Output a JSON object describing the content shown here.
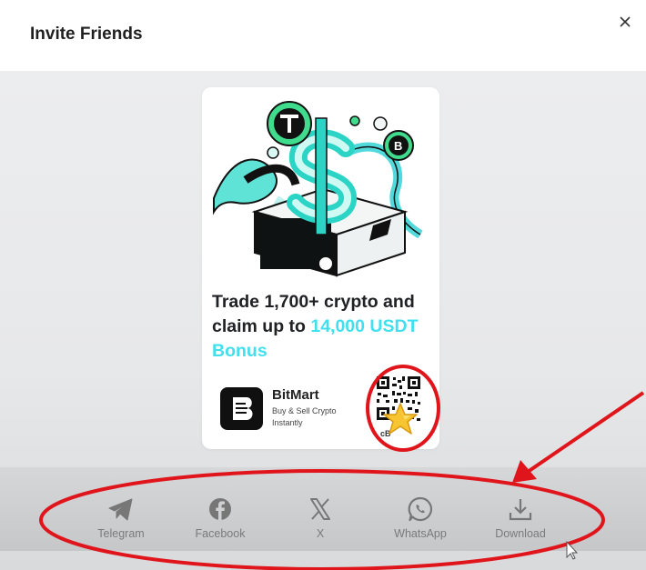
{
  "modal": {
    "title": "Invite Friends",
    "close_icon": "close-icon"
  },
  "card": {
    "headline_part1": "Trade 1,700+ crypto and claim up to ",
    "headline_highlight": "14,000 USDT Bonus",
    "app_name": "BitMart",
    "app_tagline": "Buy & Sell Crypto Instantly",
    "code_text": "cB",
    "colors": {
      "accent": "#42e0ef",
      "dark": "#101010"
    }
  },
  "share_options": [
    {
      "label": "Telegram",
      "icon": "telegram-icon"
    },
    {
      "label": "Facebook",
      "icon": "facebook-icon"
    },
    {
      "label": "X",
      "icon": "x-icon"
    },
    {
      "label": "WhatsApp",
      "icon": "whatsapp-icon"
    },
    {
      "label": "Download",
      "icon": "download-icon"
    }
  ],
  "annotations": {
    "color": "#e0151b"
  }
}
